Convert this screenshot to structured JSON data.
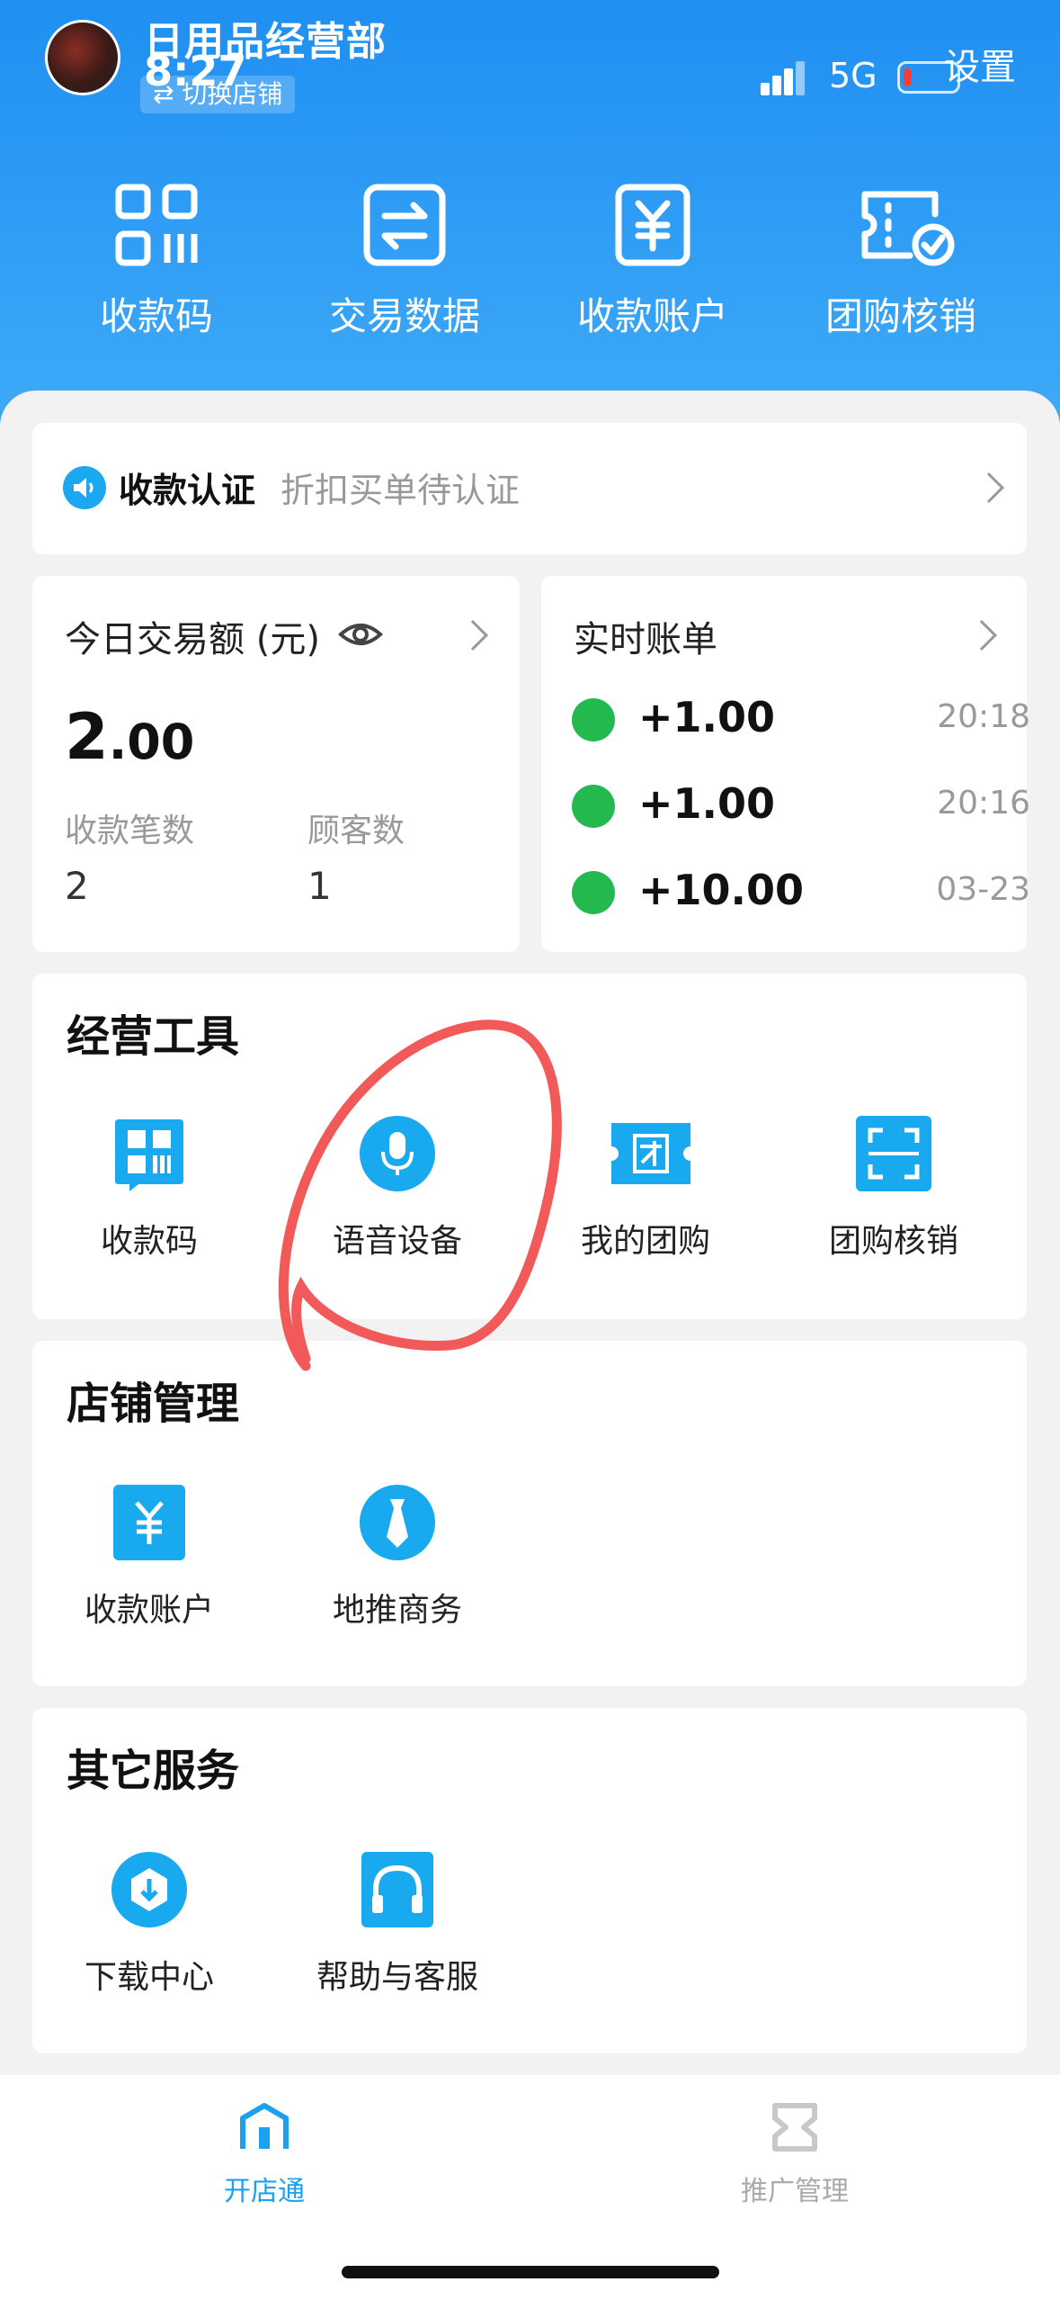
{
  "colors": {
    "accent": "#1f8ff2",
    "icon_blue": "#18a9ef",
    "wechat_green": "#23b94f",
    "annotation_red": "#f25a5a"
  },
  "status_bar": {
    "time": "8:27",
    "network": "5G"
  },
  "header": {
    "shop_name": "日用品经营部",
    "switch_store": "切换店铺",
    "settings": "设置",
    "quick_actions": [
      {
        "label": "收款码",
        "icon": "qr-code-icon"
      },
      {
        "label": "交易数据",
        "icon": "exchange-icon"
      },
      {
        "label": "收款账户",
        "icon": "yuan-account-icon"
      },
      {
        "label": "团购核销",
        "icon": "coupon-check-icon"
      }
    ]
  },
  "verify_banner": {
    "title": "收款认证",
    "subtitle": "折扣买单待认证"
  },
  "today": {
    "title": "今日交易额 (元)",
    "amount_int": "2",
    "amount_dec": ".00",
    "count_label": "收款笔数",
    "count_value": "2",
    "customers_label": "顾客数",
    "customers_value": "1"
  },
  "bills": {
    "title": "实时账单",
    "items": [
      {
        "amount": "+1.00",
        "time": "20:18"
      },
      {
        "amount": "+1.00",
        "time": "20:16"
      },
      {
        "amount": "+10.00",
        "time": "03-23"
      }
    ]
  },
  "tools": {
    "title": "经营工具",
    "items": [
      {
        "label": "收款码",
        "icon": "qr-code-icon"
      },
      {
        "label": "语音设备",
        "icon": "microphone-icon"
      },
      {
        "label": "我的团购",
        "icon": "group-buy-icon"
      },
      {
        "label": "团购核销",
        "icon": "scan-icon"
      }
    ]
  },
  "store": {
    "title": "店铺管理",
    "items": [
      {
        "label": "收款账户",
        "icon": "yuan-account-icon"
      },
      {
        "label": "地推商务",
        "icon": "tie-icon"
      }
    ]
  },
  "other": {
    "title": "其它服务",
    "items": [
      {
        "label": "下载中心",
        "icon": "download-icon"
      },
      {
        "label": "帮助与客服",
        "icon": "headset-icon"
      }
    ]
  },
  "tabbar": {
    "items": [
      {
        "label": "开店通",
        "active": true
      },
      {
        "label": "推广管理",
        "active": false
      }
    ]
  }
}
